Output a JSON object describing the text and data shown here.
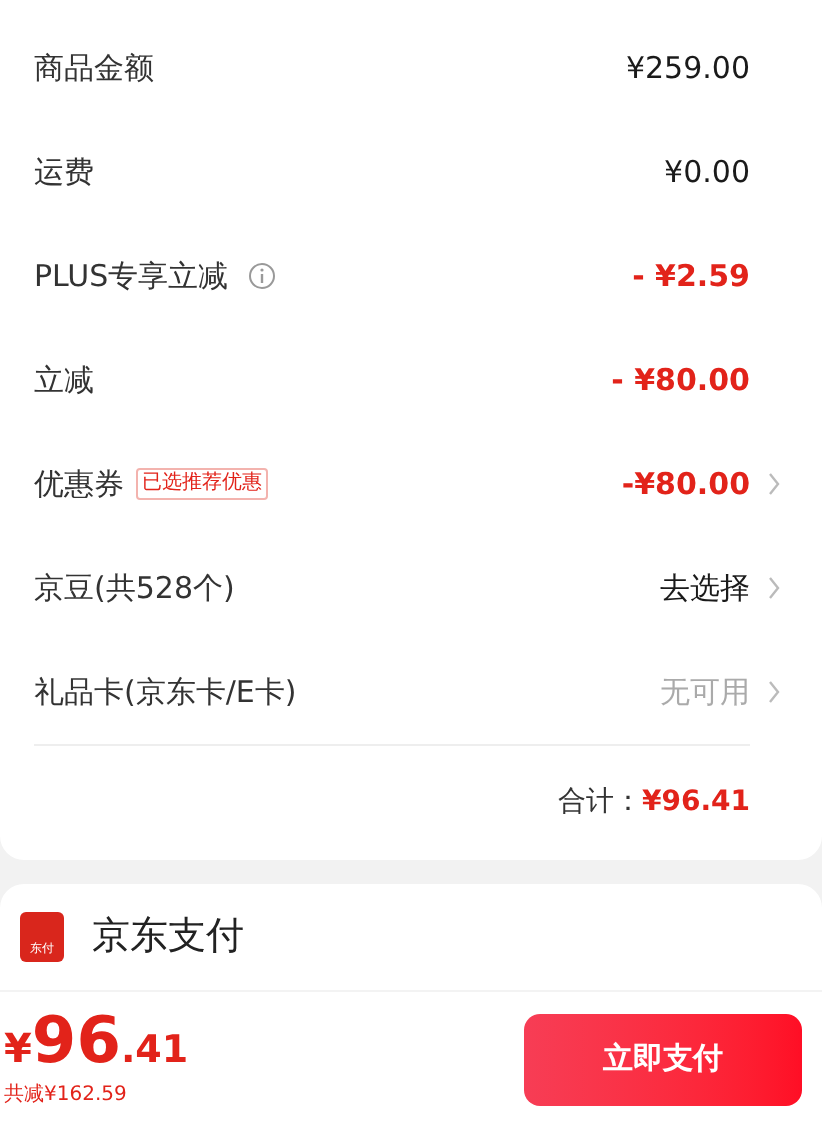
{
  "summary_rows": [
    {
      "label": "商品金额",
      "value": "¥259.00",
      "kind": "dark",
      "chevron": false,
      "info": false
    },
    {
      "label": "运费",
      "value": "¥0.00",
      "kind": "dark",
      "chevron": false,
      "info": false
    },
    {
      "label": "PLUS专享立减",
      "value": "- ¥2.59",
      "kind": "red",
      "chevron": false,
      "info": true
    },
    {
      "label": "立减",
      "value": "- ¥80.00",
      "kind": "red",
      "chevron": false,
      "info": false
    },
    {
      "label": "优惠券",
      "badge": "已选推荐优惠",
      "value": "-¥80.00",
      "kind": "red",
      "chevron": true,
      "info": false
    },
    {
      "label": "京豆(共528个)",
      "value": "去选择",
      "kind": "dark",
      "chevron": true,
      "info": false
    },
    {
      "label": "礼品卡(京东卡/E卡)",
      "value": "无可用",
      "kind": "muted",
      "chevron": true,
      "info": false
    }
  ],
  "total": {
    "label": "合计：",
    "value": "¥96.41"
  },
  "payment": {
    "icon_text": "东付",
    "name": "京东支付"
  },
  "bottom_bar": {
    "currency": "¥",
    "integer": "96",
    "decimal": ".41",
    "savings": "共减¥162.59",
    "button": "立即支付"
  }
}
